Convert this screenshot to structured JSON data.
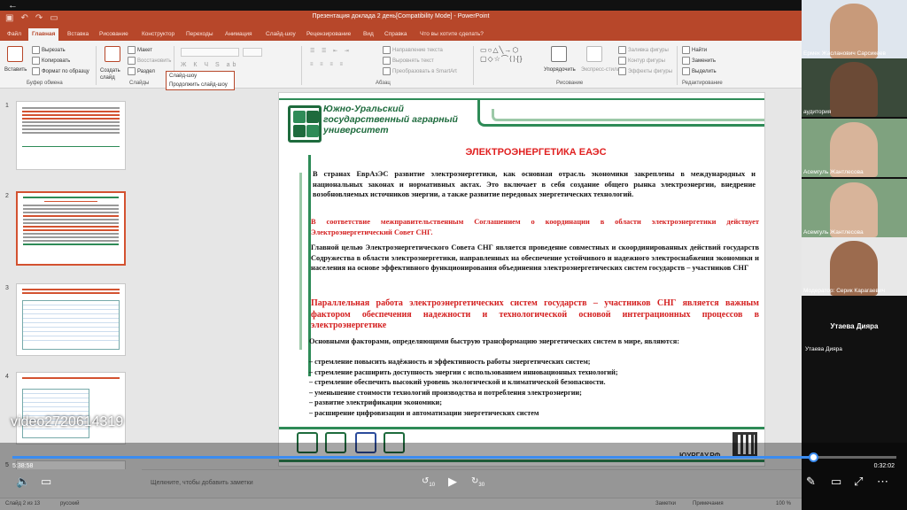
{
  "app": {
    "doc_title": "Презентация доклада 2 день[Compatibility Mode] - PowerPoint",
    "tabs": [
      "Файл",
      "Главная",
      "Вставка",
      "Рисование",
      "Конструктор",
      "Переходы",
      "Анимация",
      "Слайд-шоу",
      "Рецензирование",
      "Вид",
      "Справка",
      "Что вы хотите сделать?"
    ],
    "active_tab": "Главная",
    "accent": "#b7472a"
  },
  "ribbon": {
    "paste": "Вставить",
    "cut": "Вырезать",
    "copy": "Копировать",
    "format_painter": "Формат по образцу",
    "group_clipboard": "Буфер обмена",
    "new_slide": "Создать слайд",
    "layout": "Макет",
    "reset": "Восстановить",
    "section": "Раздел",
    "group_slides": "Слайды",
    "text_direction": "Направление текста",
    "align_text": "Выровнять текст",
    "smartart": "Преобразовать в SmartArt",
    "group_paragraph": "Абзац",
    "arrange": "Упорядочить",
    "quick_styles": "Экспресс-стили",
    "fill": "Заливка фигуры",
    "outline": "Контур фигуры",
    "effects": "Эффекты фигуры",
    "group_drawing": "Рисование",
    "find": "Найти",
    "replace": "Заменить",
    "select": "Выделить",
    "group_editing": "Редактирование",
    "dropdown_1": "Слайд-шоу",
    "dropdown_2": "Продолжить слайд-шоу"
  },
  "thumbnails": {
    "numbers": [
      "1",
      "2",
      "3",
      "4",
      "5"
    ],
    "selected": 2
  },
  "slide": {
    "university": "Южно-Уральский государственный аграрный университет",
    "title": "ЭЛЕКТРОЭНЕРГЕТИКА ЕАЭС",
    "p1": "В странах ЕврАзЭС развитие электроэнергетики, как основная отрасль экономики закреплены в международных и национальных законах и нормативных актах. Это включает в себя создание общего рынка электроэнергии, внедрение возобновляемых источников энергии, а также развитие передовых энергетических технологий.",
    "p2": "В соответствие межправительственным Соглашением о координации в области электроэнергетики действует Электроэнергетический Совет СНГ.",
    "p3": "Главной целью Электроэнергетического Совета СНГ является проведение совместных и скоординированных действий государств Содружества в области электроэнергетики, направленных на обеспечение устойчивого и надежного электроснабжения экономики и населения на основе эффективного функционирования объединения электроэнергетических систем государств – участников СНГ",
    "p4": "Параллельная работа электроэнергетических систем государств – участников СНГ является важным фактором обеспечения надежности и технологической основой интеграционных процессов в электроэнергетике",
    "p5": "Основными факторами, определяющими быструю трансформацию энергетических систем в мире, являются:",
    "bullets": [
      "– стремление повысить надёжность и эффективность работы энергетических систем;",
      "– стремление расширить доступность энергии с использованием инновационных технологий;",
      "– стремление обеспечить высокий уровень экологической и климатической безопасности.",
      "– уменьшение стоимости технологий производства и потребления электроэнергии;",
      "– развитие электрификации экономики;",
      "– расширение цифровизации и автоматизации энергетических систем"
    ],
    "footer_site": "ЮУРГАУ.РФ"
  },
  "notes_placeholder": "Щелкните, чтобы добавить заметки",
  "status": {
    "slide_of": "Слайд 2 из 13",
    "language": "русский",
    "notes_btn": "Заметки",
    "comments_btn": "Примечания",
    "zoom": "100 %"
  },
  "participants": [
    {
      "name": "Ермек Жасланович Сарсикеев",
      "face": "#c89a7a",
      "bg": "#dfe6ee"
    },
    {
      "name": "аудитория",
      "face": "#6b4a36",
      "bg": "#3a4a3a"
    },
    {
      "name": "Асемгуль Жантлесова",
      "face": "#d8b49a",
      "bg": "#7fa27f"
    },
    {
      "name": "Асемгуль Жантлесова",
      "face": "#d8b49a",
      "bg": "#7fa27f"
    },
    {
      "name": "Модератор: Серик Карагаевич",
      "face": "#9c6b4e",
      "bg": "#e8e8e8"
    }
  ],
  "speaker_big": "Утаева Дияра",
  "speaker_small": "Утаева Дияра",
  "video": {
    "label": "video2720614319",
    "current": "5:38:58",
    "duration": "0:32:02",
    "progress": 0.906,
    "rewind": "10",
    "forward": "30"
  }
}
